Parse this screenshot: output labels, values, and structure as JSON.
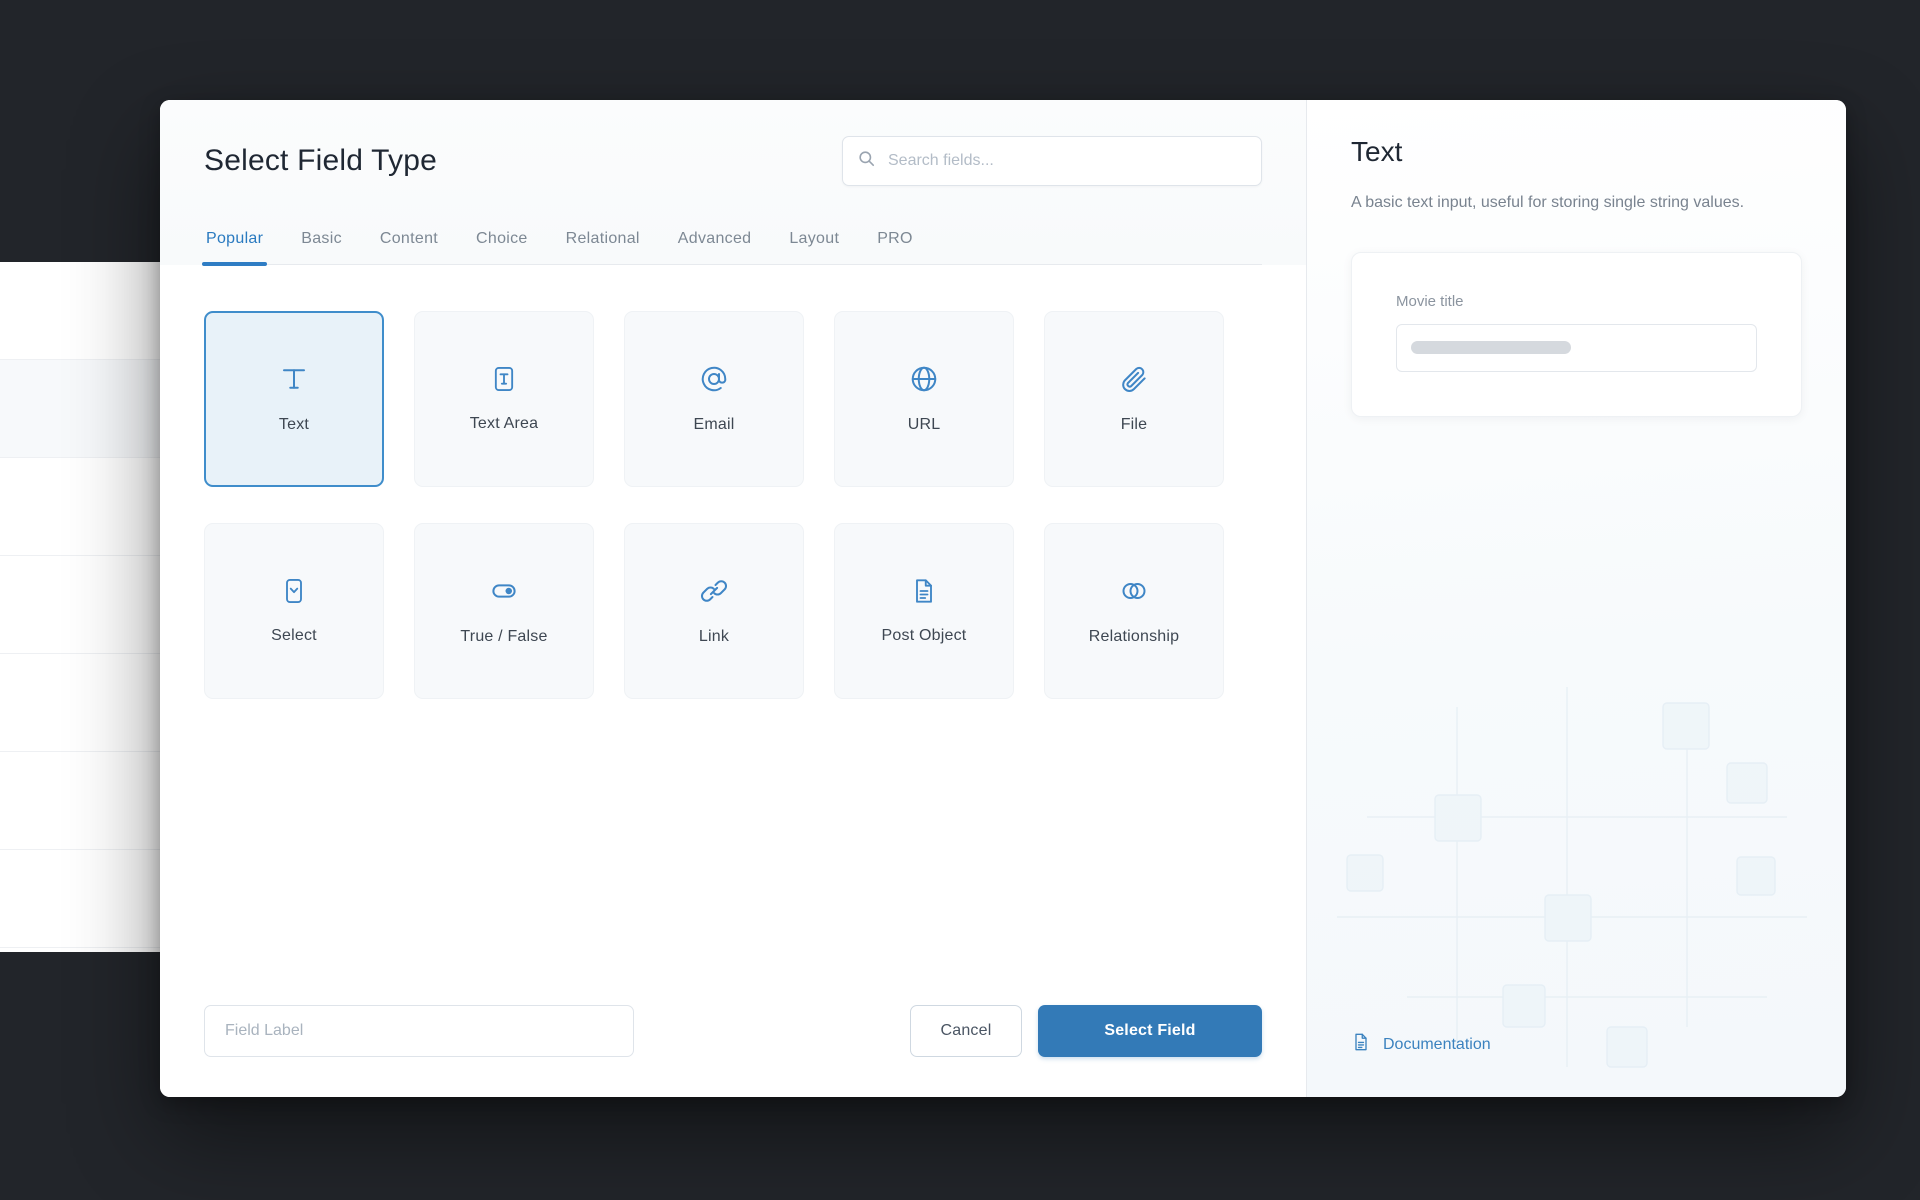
{
  "modal": {
    "title": "Select Field Type",
    "search": {
      "placeholder": "Search fields...",
      "value": ""
    },
    "tabs": [
      {
        "label": "Popular",
        "active": true
      },
      {
        "label": "Basic",
        "active": false
      },
      {
        "label": "Content",
        "active": false
      },
      {
        "label": "Choice",
        "active": false
      },
      {
        "label": "Relational",
        "active": false
      },
      {
        "label": "Advanced",
        "active": false
      },
      {
        "label": "Layout",
        "active": false
      },
      {
        "label": "PRO",
        "active": false
      }
    ],
    "field_types": [
      {
        "label": "Text",
        "icon": "text-icon",
        "selected": true
      },
      {
        "label": "Text Area",
        "icon": "text-area-icon",
        "selected": false
      },
      {
        "label": "Email",
        "icon": "email-icon",
        "selected": false
      },
      {
        "label": "URL",
        "icon": "globe-icon",
        "selected": false
      },
      {
        "label": "File",
        "icon": "paperclip-icon",
        "selected": false
      },
      {
        "label": "Select",
        "icon": "select-icon",
        "selected": false
      },
      {
        "label": "True / False",
        "icon": "toggle-icon",
        "selected": false
      },
      {
        "label": "Link",
        "icon": "link-icon",
        "selected": false
      },
      {
        "label": "Post Object",
        "icon": "document-icon",
        "selected": false
      },
      {
        "label": "Relationship",
        "icon": "relationship-icon",
        "selected": false
      }
    ],
    "footer": {
      "field_label_placeholder": "Field Label",
      "field_label_value": "",
      "cancel_label": "Cancel",
      "submit_label": "Select Field"
    }
  },
  "details": {
    "title": "Text",
    "description": "A basic text input, useful for storing single string values.",
    "preview": {
      "label": "Movie title",
      "value": ""
    },
    "documentation_label": "Documentation"
  },
  "colors": {
    "accent": "#337ab7",
    "icon_blue": "#3f86c6",
    "tab_active": "#2f7dc4",
    "backdrop": "#22252a",
    "card_bg": "#f7f9fb",
    "card_selected_bg": "#e8f2f9"
  }
}
